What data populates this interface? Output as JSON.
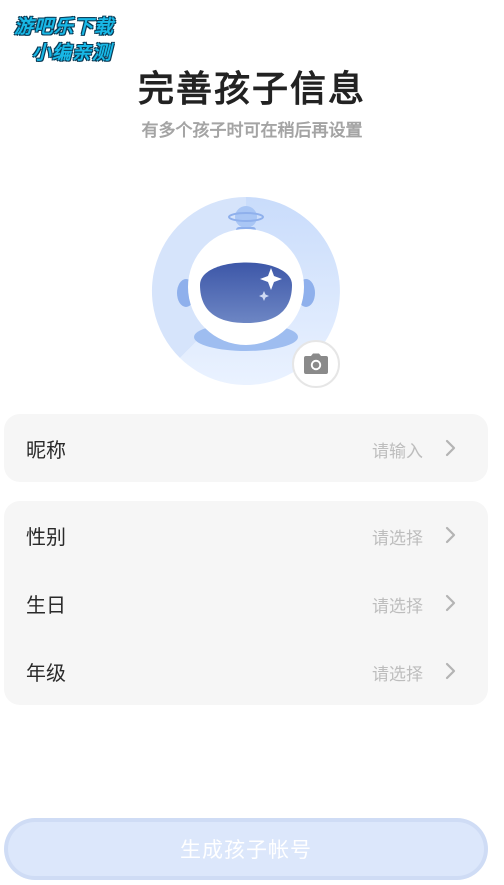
{
  "watermark": {
    "line1": "游吧乐下载",
    "line2": "小编亲测"
  },
  "header": {
    "title": "完善孩子信息",
    "subtitle": "有多个孩子时可在稍后再设置"
  },
  "avatar": {
    "icon": "astronaut-avatar-icon",
    "camera_icon": "camera-icon"
  },
  "form": {
    "nickname": {
      "label": "昵称",
      "placeholder": "请输入"
    },
    "gender": {
      "label": "性别",
      "placeholder": "请选择"
    },
    "birthday": {
      "label": "生日",
      "placeholder": "请选择"
    },
    "grade": {
      "label": "年级",
      "placeholder": "请选择"
    }
  },
  "submit": {
    "label": "生成孩子帐号"
  },
  "colors": {
    "accent_light": "#cfdcf5",
    "card_bg": "#f6f6f6",
    "placeholder": "#bdbdbd"
  }
}
